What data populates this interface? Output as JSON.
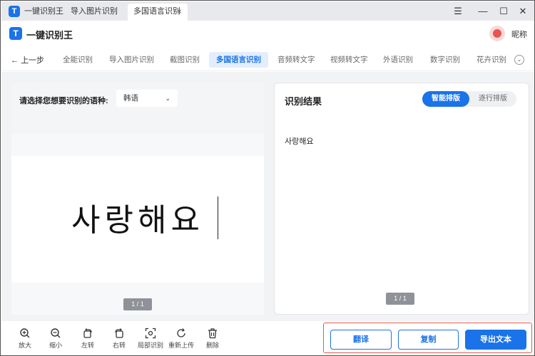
{
  "titlebar": {
    "tabs": [
      {
        "label": "一键识别王"
      },
      {
        "label": "导入图片识别"
      },
      {
        "label": "多国语言识别"
      }
    ],
    "close_tab_glyph": "×",
    "controls": {
      "menu": "☰",
      "minimize": "—",
      "maximize": "☐",
      "close": "✕"
    }
  },
  "header": {
    "app_title": "一键识别王",
    "user_name": "昵称"
  },
  "nav": {
    "back_label": "上一步",
    "items": [
      {
        "label": "全能识别"
      },
      {
        "label": "导入图片识别"
      },
      {
        "label": "截图识别"
      },
      {
        "label": "多国语言识别"
      },
      {
        "label": "音频转文字"
      },
      {
        "label": "视频转文字"
      },
      {
        "label": "外语识别"
      },
      {
        "label": "数字识别"
      },
      {
        "label": "花卉识别"
      }
    ],
    "more_glyph": "⌄"
  },
  "source": {
    "lang_label": "请选择您想要识别的语种:",
    "lang_value": "韩语",
    "image_text": "사랑해요",
    "page_indicator": "1 / 1"
  },
  "result": {
    "title": "识别结果",
    "mode_smart": "智能排版",
    "mode_line": "逐行排版",
    "text": "사랑해요",
    "page_indicator": "1 / 1"
  },
  "toolbar": {
    "tools": [
      {
        "label": "放大",
        "icon": "zoom-in-icon"
      },
      {
        "label": "缩小",
        "icon": "zoom-out-icon"
      },
      {
        "label": "左转",
        "icon": "rotate-left-icon"
      },
      {
        "label": "右转",
        "icon": "rotate-right-icon"
      },
      {
        "label": "局部识别",
        "icon": "partial-recognize-icon"
      },
      {
        "label": "重新上传",
        "icon": "reupload-icon"
      },
      {
        "label": "删除",
        "icon": "trash-icon"
      }
    ],
    "translate_label": "翻译",
    "copy_label": "复制",
    "export_label": "导出文本"
  },
  "colors": {
    "accent": "#1a73e8",
    "highlight_box": "#e25a4e"
  }
}
